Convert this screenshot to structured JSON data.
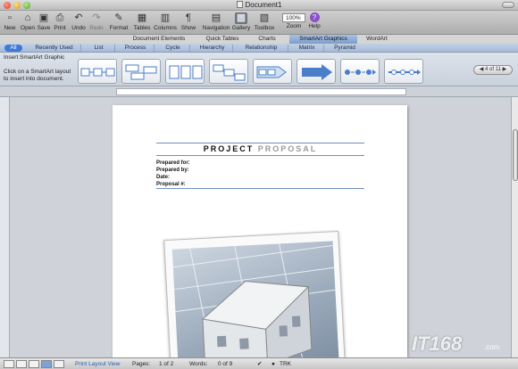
{
  "window": {
    "title": "Document1"
  },
  "toolbar": {
    "items": [
      {
        "label": "New",
        "icon": "new-document-icon",
        "glyph": "▫"
      },
      {
        "label": "Open",
        "icon": "open-folder-icon",
        "glyph": "⌂"
      },
      {
        "label": "Save",
        "icon": "save-icon",
        "glyph": "▣"
      },
      {
        "label": "Print",
        "icon": "print-icon",
        "glyph": "⎙"
      },
      {
        "label": "Undo",
        "icon": "undo-icon",
        "glyph": "↶"
      },
      {
        "label": "Redo",
        "icon": "redo-icon",
        "glyph": "↷"
      },
      {
        "label": "Format",
        "icon": "format-brush-icon",
        "glyph": "✎"
      },
      {
        "label": "Tables",
        "icon": "tables-icon",
        "glyph": "▦"
      },
      {
        "label": "Columns",
        "icon": "columns-icon",
        "glyph": "▥"
      },
      {
        "label": "Show",
        "icon": "paragraph-icon",
        "glyph": "¶"
      },
      {
        "label": "Navigation",
        "icon": "navigation-icon",
        "glyph": "▤"
      },
      {
        "label": "Gallery",
        "icon": "gallery-icon",
        "glyph": "▩"
      },
      {
        "label": "Toolbox",
        "icon": "toolbox-icon",
        "glyph": "▧"
      },
      {
        "label": "Zoom",
        "icon": "zoom-icon",
        "glyph": ""
      },
      {
        "label": "Help",
        "icon": "help-icon",
        "glyph": "?"
      }
    ],
    "zoom_value": "100%"
  },
  "ribbon_tabs": [
    "Document Elements",
    "Quick Tables",
    "Charts",
    "SmartArt Graphics",
    "WordArt"
  ],
  "active_tab": "SmartArt Graphics",
  "filters": [
    "All",
    "Recently Used",
    "List",
    "Process",
    "Cycle",
    "Hierarchy",
    "Relationship",
    "Matrix",
    "Pyramid"
  ],
  "gallery": {
    "title": "Insert SmartArt Graphic",
    "hint": "Click on a SmartArt layout to insert into document.",
    "pager": "4 of 11",
    "accent": "#4a7ec8"
  },
  "document": {
    "title_part1": "PROJECT",
    "title_part2": "PROPOSAL",
    "fields": [
      "Prepared for:",
      "Prepared by:",
      "Date:",
      "Proposal #:"
    ]
  },
  "status": {
    "view_name": "Print Layout View",
    "pages_label": "Pages:",
    "pages_value": "1 of 2",
    "words_label": "Words:",
    "words_value": "0 of 9",
    "track": "TRK"
  },
  "watermark": {
    "text": "IT168",
    "suffix": ".com"
  }
}
